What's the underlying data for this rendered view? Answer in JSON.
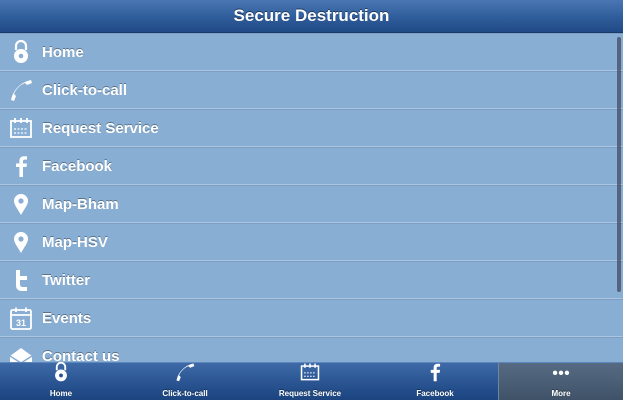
{
  "header": {
    "title": "Secure Destruction"
  },
  "menu": {
    "items": [
      {
        "label": "Home",
        "icon": "lock-icon"
      },
      {
        "label": "Click-to-call",
        "icon": "phone-icon"
      },
      {
        "label": "Request Service",
        "icon": "calendar-form-icon"
      },
      {
        "label": "Facebook",
        "icon": "facebook-icon"
      },
      {
        "label": "Map-Bham",
        "icon": "map-pin-icon"
      },
      {
        "label": "Map-HSV",
        "icon": "map-pin-icon"
      },
      {
        "label": "Twitter",
        "icon": "twitter-icon"
      },
      {
        "label": "Events",
        "icon": "calendar-icon"
      },
      {
        "label": "Contact us",
        "icon": "mail-icon"
      }
    ]
  },
  "tabbar": {
    "tabs": [
      {
        "label": "Home",
        "icon": "lock-icon"
      },
      {
        "label": "Click-to-call",
        "icon": "phone-icon"
      },
      {
        "label": "Request Service",
        "icon": "calendar-form-icon"
      },
      {
        "label": "Facebook",
        "icon": "facebook-icon"
      },
      {
        "label": "More",
        "icon": "more-dots-icon",
        "active": true
      }
    ]
  },
  "colors": {
    "title_bar": "#2f5d9b",
    "list_bg": "#89aed3",
    "tab_bar": "#27528f",
    "active_tab": "#4a5d74"
  }
}
